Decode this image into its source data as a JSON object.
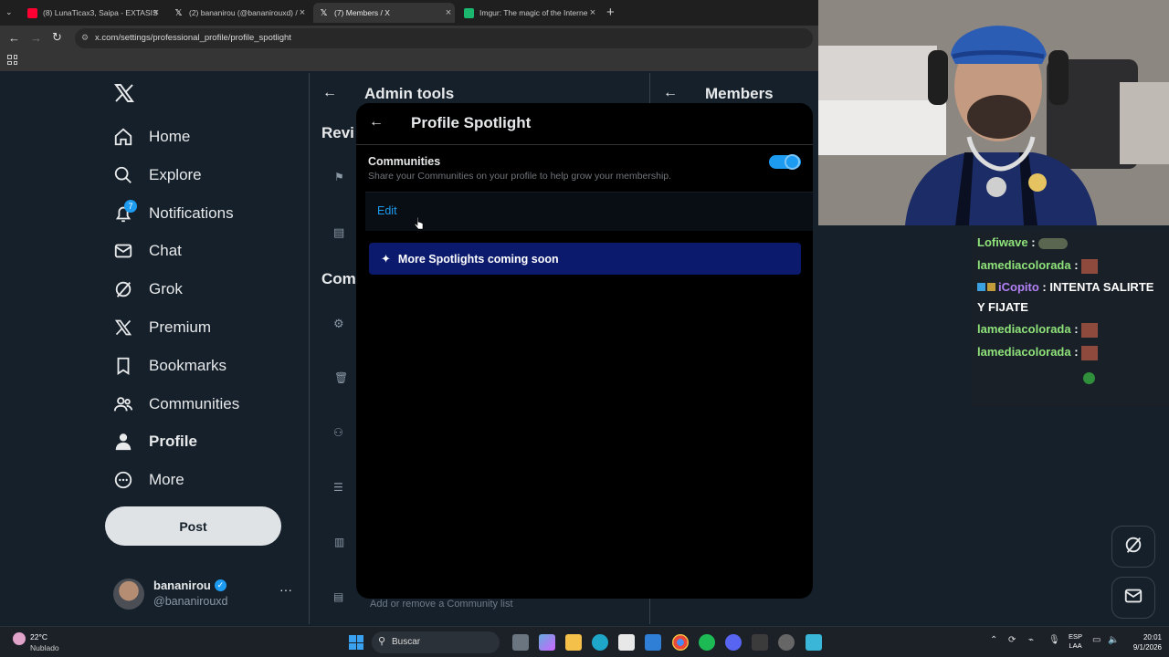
{
  "browser": {
    "tabs": [
      {
        "title": "(8) LunaTicax3, Saipa - EXTASIS"
      },
      {
        "title": "(2) bananirou (@bananirouxd) /"
      },
      {
        "title": "(7) Members / X"
      },
      {
        "title": "Imgur: The magic of the Interne"
      }
    ],
    "url": "x.com/settings/professional_profile/profile_spotlight",
    "colors": {
      "youtube": "#ff0033",
      "imgur": "#1bb76e"
    }
  },
  "nav": {
    "items": [
      {
        "label": "Home",
        "icon": "home-icon"
      },
      {
        "label": "Explore",
        "icon": "search-icon"
      },
      {
        "label": "Notifications",
        "icon": "bell-icon",
        "badge": "7"
      },
      {
        "label": "Chat",
        "icon": "mail-icon"
      },
      {
        "label": "Grok",
        "icon": "grok-icon"
      },
      {
        "label": "Premium",
        "icon": "x-logo-icon"
      },
      {
        "label": "Bookmarks",
        "icon": "bookmark-icon"
      },
      {
        "label": "Communities",
        "icon": "people-icon"
      },
      {
        "label": "Profile",
        "icon": "person-icon"
      },
      {
        "label": "More",
        "icon": "more-circle-icon"
      }
    ],
    "post_label": "Post",
    "account": {
      "name": "bananirou",
      "handle": "@bananirouxd"
    }
  },
  "middle": {
    "title": "Admin tools",
    "section_review": "Revi",
    "section_community": "Com",
    "footer_text": "Add or remove a Community list"
  },
  "right": {
    "title": "Members"
  },
  "modal": {
    "title": "Profile Spotlight",
    "communities_label": "Communities",
    "communities_desc": "Share your Communities on your profile to help grow your membership.",
    "toggle_on": true,
    "edit_label": "Edit",
    "banner_label": "More Spotlights coming soon",
    "accent": "#1d9bf0",
    "banner_color": "#0c1a6e"
  },
  "stream_chat": [
    {
      "user": "Lofiwave",
      "text": ":"
    },
    {
      "user": "lamediacolorada",
      "text": ":"
    },
    {
      "user": "iCopito",
      "text": ": INTENTA SALIRTE"
    },
    {
      "user": "",
      "text": "Y FIJATE"
    },
    {
      "user": "lamediacolorada",
      "text": ":"
    },
    {
      "user": "lamediacolorada",
      "text": ":"
    }
  ],
  "taskbar": {
    "weather_temp": "22°C",
    "weather_desc": "Nublado",
    "search_placeholder": "Buscar",
    "lang_top": "ESP",
    "lang_bottom": "LAA",
    "time": "20:01",
    "date": "9/1/2026"
  }
}
